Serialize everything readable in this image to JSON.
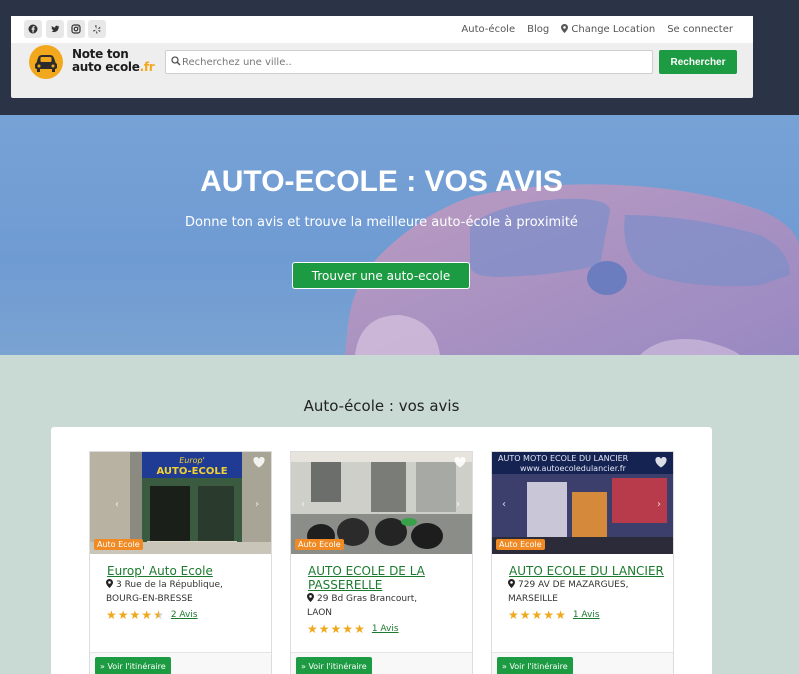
{
  "nav": {
    "social_icons": [
      "facebook-icon",
      "twitter-icon",
      "instagram-icon",
      "yelp-icon"
    ],
    "links": [
      "Auto-école",
      "Blog",
      "Change Location",
      "Se connecter"
    ]
  },
  "logo": {
    "line1": "Note ton",
    "line2": "auto ecole",
    "suffix": ".fr"
  },
  "search": {
    "placeholder": "Recherchez une ville..",
    "button": "Rechercher"
  },
  "hero": {
    "title": "AUTO-ECOLE : VOS AVIS",
    "subtitle": "Donne ton avis et trouve la meilleure auto-école à proximité",
    "button": "Trouver une auto-ecole"
  },
  "section": {
    "title": "Auto-école : vos avis"
  },
  "cards": [
    {
      "badge": "Auto Ecole",
      "title": "Europ' Auto Ecole",
      "address": "3 Rue de la République,",
      "city": "BOURG-EN-BRESSE",
      "rating": 4.5,
      "reviews": "2 Avis",
      "button": "Voir l'itinéraire",
      "sign": "Europ' AUTO-ECOLE"
    },
    {
      "badge": "Auto Ecole",
      "title": "AUTO ECOLE DE LA PASSERELLE",
      "address": "29 Bd Gras Brancourt,",
      "city": "LAON",
      "rating": 5,
      "reviews": "1 Avis",
      "button": "Voir l'itinéraire"
    },
    {
      "badge": "Auto Ecole",
      "title": "AUTO ECOLE DU LANCIER",
      "address": "729 AV DE MAZARGUES,",
      "city": "MARSEILLE",
      "rating": 5,
      "reviews": "1 Avis",
      "button": "Voir l'itinéraire",
      "sign": "AUTO MOTO ECOLE DU LANCIER",
      "sign_url": "www.autoecoledulancier.fr"
    }
  ],
  "colors": {
    "primary": "#1c9b42",
    "accent": "#f08a24",
    "star": "#f0a81c",
    "header": "#2b3447"
  }
}
